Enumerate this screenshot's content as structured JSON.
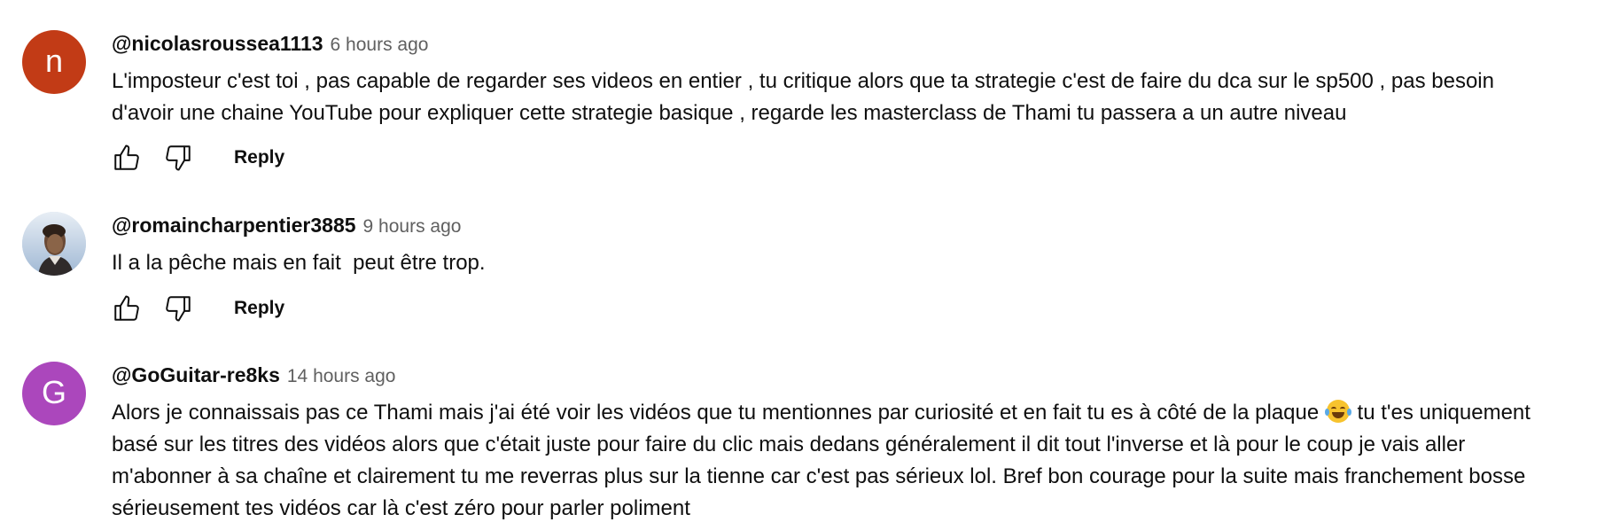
{
  "comments": [
    {
      "avatar_letter": "n",
      "avatar_color": "#c23b16",
      "author": "@nicolasroussea1113",
      "time": "6 hours ago",
      "text": "L'imposteur c'est toi , pas capable de regarder ses videos en entier , tu critique alors que ta strategie c'est de faire du dca sur le sp500 , pas besoin\nd'avoir une chaine YouTube pour expliquer cette strategie basique , regarde les masterclass de Thami tu passera a un autre niveau",
      "reply_label": "Reply"
    },
    {
      "avatar_letter": "",
      "avatar_color": "#c9d8e8",
      "author": "@romaincharpentier3885",
      "time": "9 hours ago",
      "text": "Il a la pêche mais en fait  peut être trop.",
      "reply_label": "Reply"
    },
    {
      "avatar_letter": "G",
      "avatar_color": "#ab47bc",
      "author": "@GoGuitar-re8ks",
      "time": "14 hours ago",
      "text_part1": "Alors je connaissais pas ce Thami mais j'ai été voir les vidéos que tu mentionnes par curiosité et en fait tu es à côté de la plaque ",
      "emoji": "😂",
      "text_part2": " tu t'es uniquement\nbasé sur les titres des vidéos alors que c'était juste pour faire du clic mais dedans généralement il dit tout l'inverse et là pour le coup je vais aller\nm'abonner à sa chaîne et clairement tu me reverras plus sur la tienne car c'est pas sérieux lol. Bref bon courage pour la suite mais franchement bosse\nsérieusement tes vidéos car là c'est zéro pour parler poliment"
    }
  ],
  "icons": {
    "like": "thumbs-up-icon",
    "dislike": "thumbs-down-icon",
    "emoji": "face-with-tears-of-joy-emoji"
  }
}
